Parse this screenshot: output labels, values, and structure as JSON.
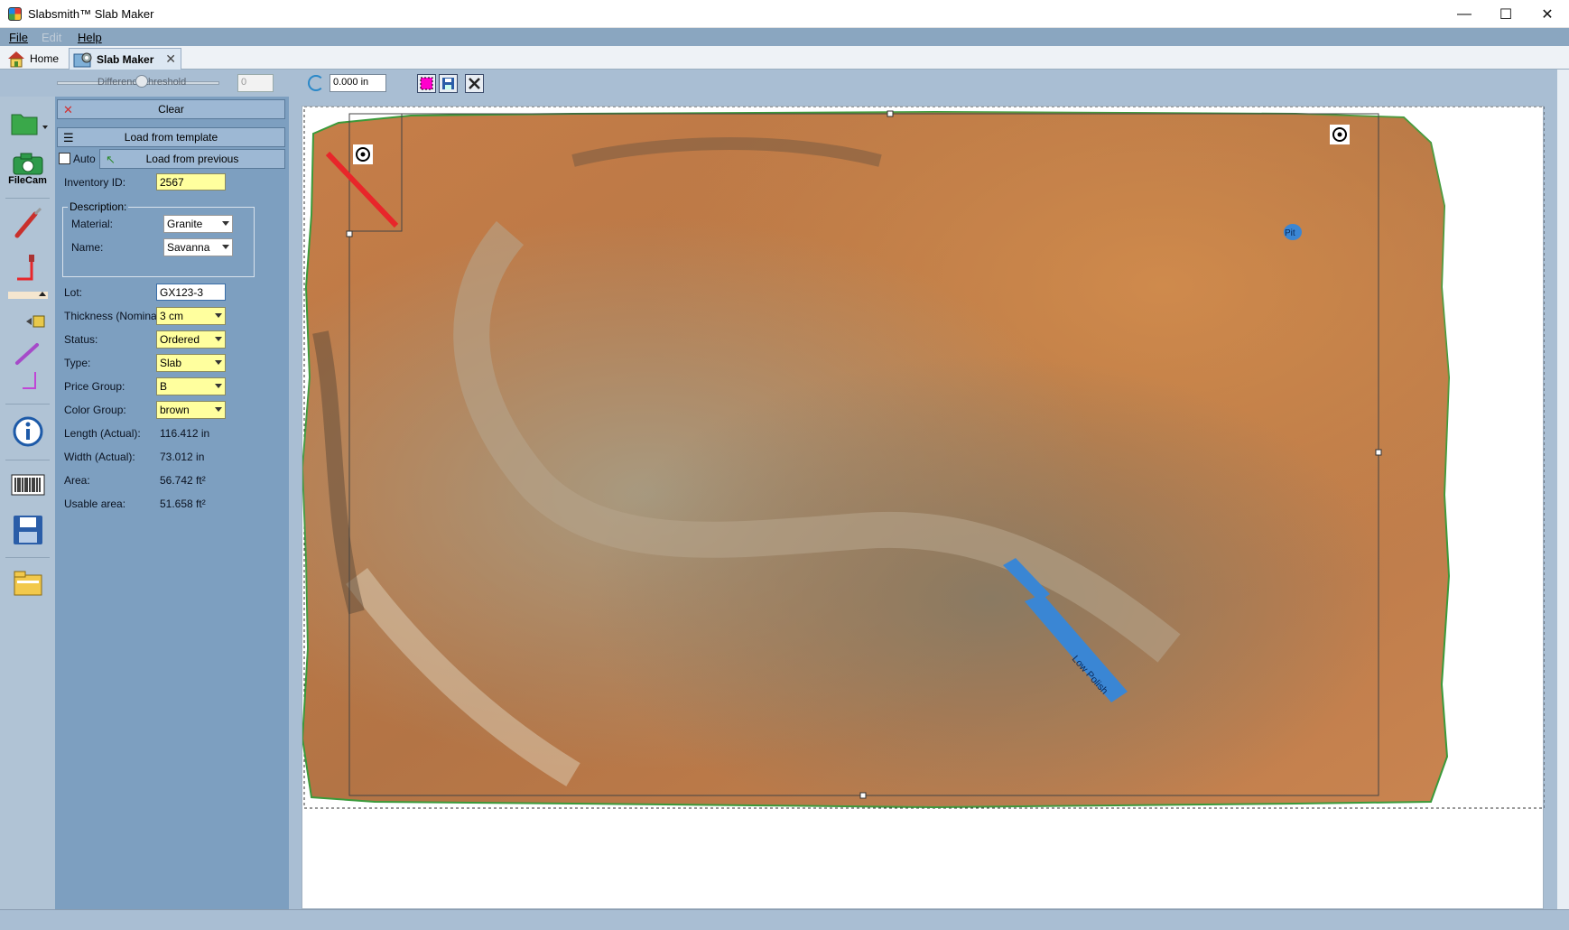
{
  "window": {
    "title": "Slabsmith™ Slab Maker",
    "minimize": "—",
    "maximize": "☐",
    "close": "✕"
  },
  "menu": {
    "file": "File",
    "edit": "Edit",
    "help": "Help"
  },
  "tabs": {
    "home": "Home",
    "slab_maker": "Slab Maker",
    "close": "✕"
  },
  "toolbar": {
    "slider_label": "Difference threshold",
    "threshold_value": "0",
    "offset_value": "0.000 in",
    "slider_level": 0.45
  },
  "sidebar": {
    "filecam_label": "FileCam",
    "icons": [
      "folder-open-icon",
      "camera-icon",
      "brush-icon",
      "marker-red-icon",
      "camera-small-icon",
      "brush-purple-icon",
      "info-icon",
      "barcode-icon",
      "save-icon",
      "folder-icon"
    ]
  },
  "panel": {
    "clear": "Clear",
    "load_template": "Load from template",
    "auto": "Auto",
    "load_previous": "Load from previous",
    "inventory_id_label": "Inventory ID:",
    "inventory_id": "2567",
    "description_label": "Description:",
    "material_label": "Material:",
    "material": "Granite",
    "name_label": "Name:",
    "name": "Savanna",
    "lot_label": "Lot:",
    "lot": "GX123-3",
    "thickness_label": "Thickness (Nominal):",
    "thickness": "3 cm",
    "status_label": "Status:",
    "status": "Ordered",
    "type_label": "Type:",
    "type": "Slab",
    "price_group_label": "Price Group:",
    "price_group": "B",
    "color_group_label": "Color Group:",
    "color_group": "brown",
    "length_label": "Length (Actual):",
    "length": "116.412 in",
    "width_label": "Width (Actual):",
    "width": "73.012 in",
    "area_label": "Area:",
    "area": "56.742 ft²",
    "usable_area_label": "Usable area:",
    "usable_area": "51.658 ft²"
  },
  "canvas": {
    "pit_label": "Pit",
    "low_polish_label": "Low Polish",
    "colors": {
      "slab_base": "#c07a45",
      "slab_light": "#d9a271",
      "slab_dark": "#6e5a45",
      "vein": "#b3a58e",
      "outline": "#3a9a3a",
      "defect_blue": "#3a86d4",
      "cut_red": "#e8262a"
    }
  }
}
